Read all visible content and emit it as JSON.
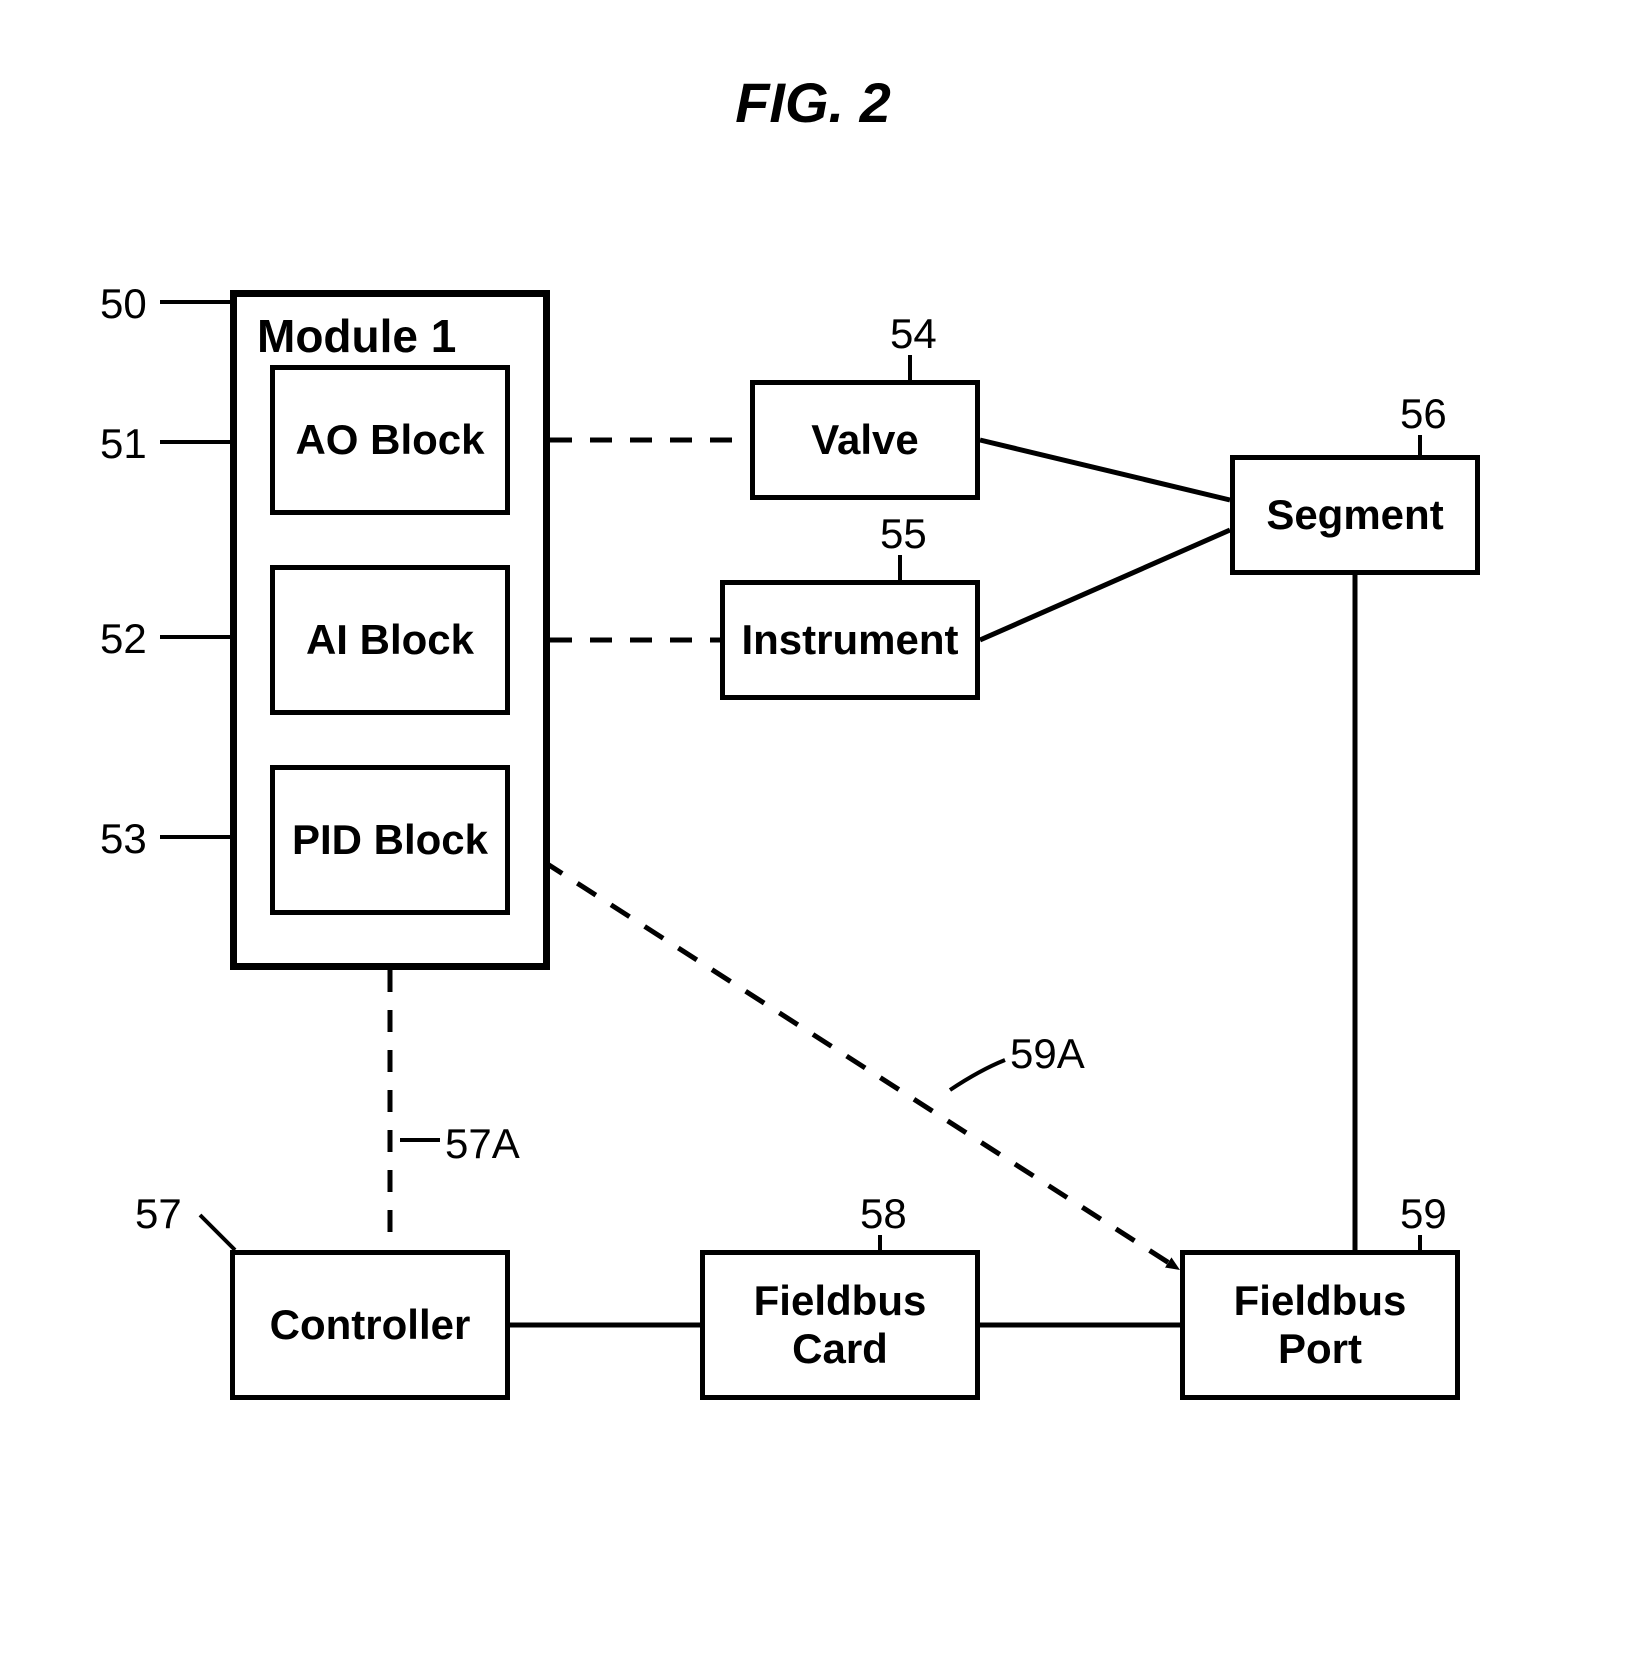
{
  "figure_title": "FIG. 2",
  "module": {
    "title": "Module 1",
    "blocks": {
      "ao": "AO Block",
      "ai": "AI Block",
      "pid": "PID Block"
    }
  },
  "boxes": {
    "valve": "Valve",
    "instrument": "Instrument",
    "segment": "Segment",
    "controller": "Controller",
    "fieldbus_card": "Fieldbus\nCard",
    "fieldbus_port": "Fieldbus\nPort"
  },
  "refs": {
    "r50": "50",
    "r51": "51",
    "r52": "52",
    "r53": "53",
    "r54": "54",
    "r55": "55",
    "r56": "56",
    "r57": "57",
    "r57A": "57A",
    "r58": "58",
    "r59": "59",
    "r59A": "59A"
  }
}
